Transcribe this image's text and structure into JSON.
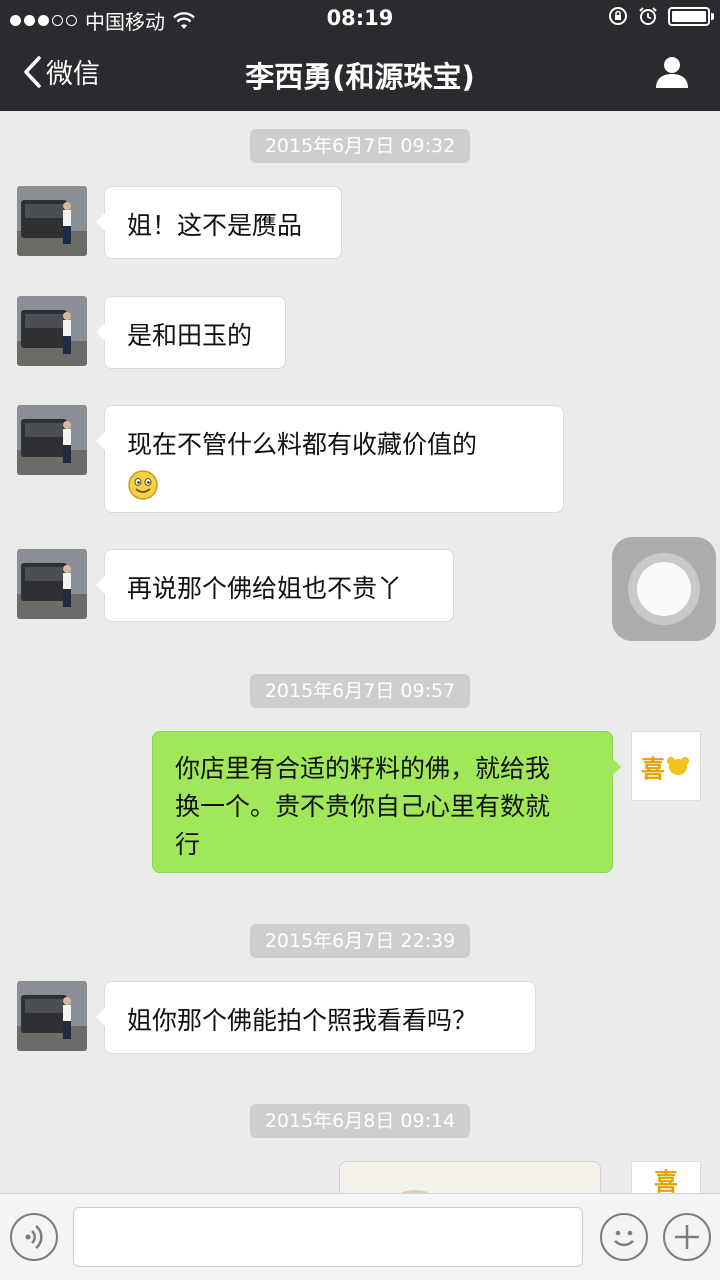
{
  "status_bar": {
    "carrier": "中国移动",
    "time": "08:19"
  },
  "nav": {
    "back_label": "微信",
    "title": "李西勇(和源珠宝)"
  },
  "messages": {
    "stamp1": "2015年6月7日 09:32",
    "m1": "姐！这不是赝品",
    "m2": "是和田玉的",
    "m3": "现在不管什么料都有收藏价值的",
    "m4": "再说那个佛给姐也不贵丫",
    "stamp2": "2015年6月7日 09:57",
    "m5_line1": "你店里有合适的籽料的佛，就给我",
    "m5_line2": "换一个。贵不贵你自己心里有数就",
    "m5_line3": "行",
    "stamp3": "2015年6月7日 22:39",
    "m6": "姐你那个佛能拍个照我看看吗？",
    "stamp4": "2015年6月8日 09:14"
  },
  "self_avatar_text": "喜"
}
